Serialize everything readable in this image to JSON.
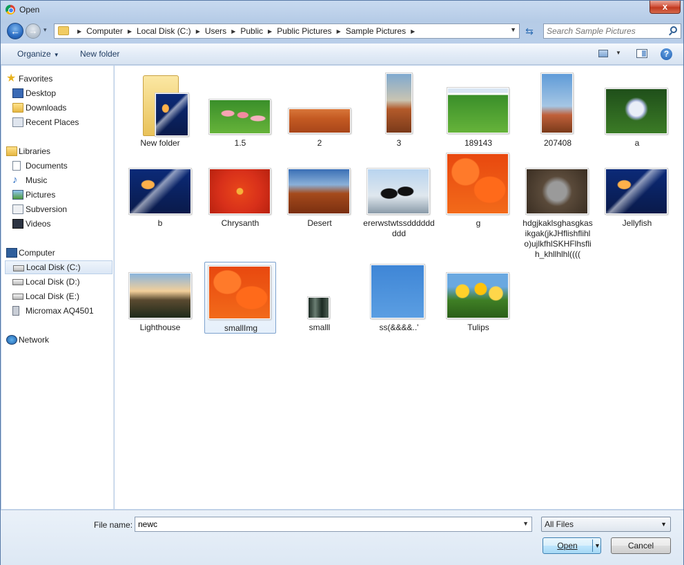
{
  "window": {
    "title": "Open",
    "close_label": "x"
  },
  "nav": {
    "back_glyph": "←",
    "forward_glyph": "→",
    "recent_glyph": "▾",
    "refresh_glyph": "⇆"
  },
  "address": {
    "crumbs": [
      "Computer",
      "Local Disk (C:)",
      "Users",
      "Public",
      "Public Pictures",
      "Sample Pictures"
    ],
    "separator": "▶",
    "dropdown": "▼"
  },
  "search": {
    "placeholder": "Search Sample Pictures"
  },
  "toolbar": {
    "organize_label": "Organize",
    "caret": "▼",
    "new_folder_label": "New folder",
    "help_glyph": "?"
  },
  "sidebar": {
    "favorites": {
      "label": "Favorites",
      "items": [
        "Desktop",
        "Downloads",
        "Recent Places"
      ]
    },
    "libraries": {
      "label": "Libraries",
      "items": [
        "Documents",
        "Music",
        "Pictures",
        "Subversion",
        "Videos"
      ]
    },
    "computer": {
      "label": "Computer",
      "items": [
        "Local Disk (C:)",
        "Local Disk (D:)",
        "Local Disk (E:)",
        "Micromax AQ4501"
      ]
    },
    "network": {
      "label": "Network"
    }
  },
  "files": [
    {
      "name": "New folder",
      "type": "folder"
    },
    {
      "name": "1.5"
    },
    {
      "name": "2"
    },
    {
      "name": "3"
    },
    {
      "name": "189143"
    },
    {
      "name": "207408"
    },
    {
      "name": "a"
    },
    {
      "name": "b"
    },
    {
      "name": "Chrysanth"
    },
    {
      "name": "Desert"
    },
    {
      "name": "ererwstwtssddddddddd"
    },
    {
      "name": "g"
    },
    {
      "name": "hdgjkaklsghasgkasikgak(jkJHflishflihlo)ujlkfhlSKHFlhsflih_khllhlhl(((("
    },
    {
      "name": "Jellyfish"
    },
    {
      "name": "Lighthouse"
    },
    {
      "name": "smallImg",
      "selected": true
    },
    {
      "name": "smalll"
    },
    {
      "name": "ss(&&&&..'"
    },
    {
      "name": "Tulips"
    }
  ],
  "footer": {
    "file_name_label": "File name:",
    "file_name_value": "newc",
    "filter_value": "All Files",
    "open_label": "Open",
    "cancel_label": "Cancel"
  }
}
